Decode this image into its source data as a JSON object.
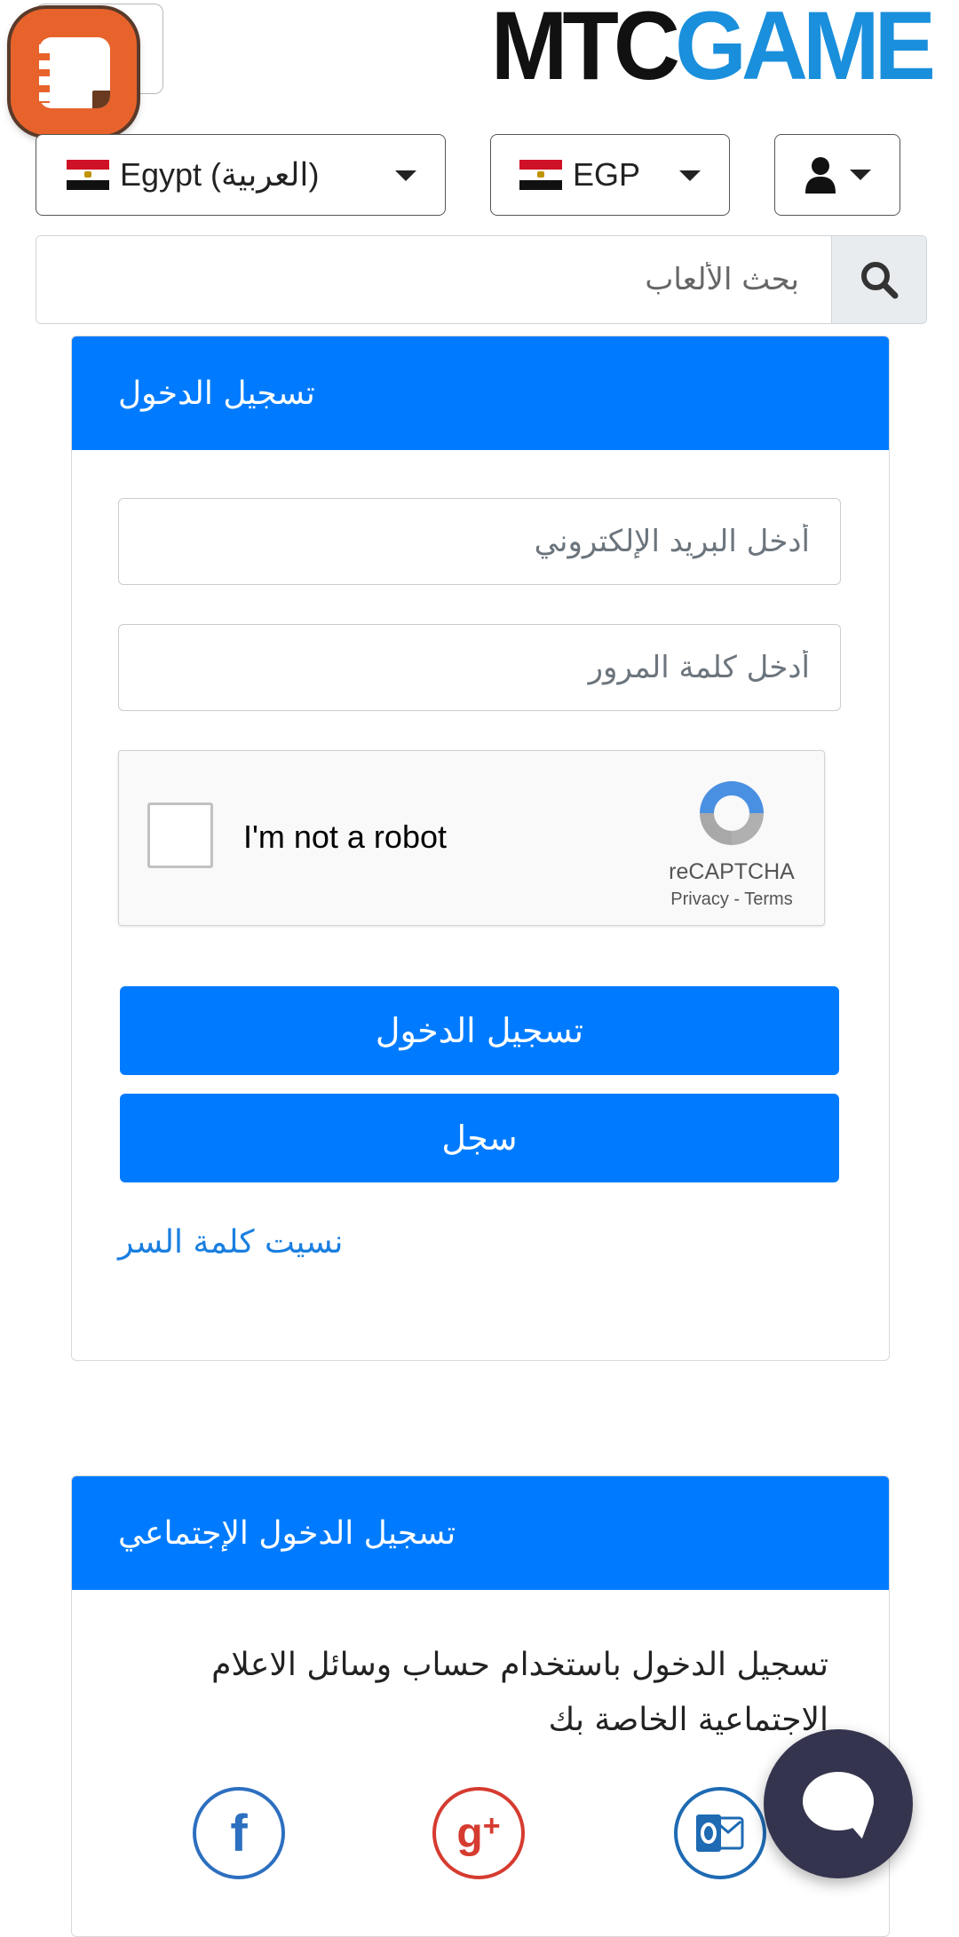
{
  "header": {
    "logo_part1": "MTC",
    "logo_part2": "GAME",
    "country_label": "Egypt (العربية)",
    "currency_label": "EGP",
    "search_placeholder": "بحث الألعاب"
  },
  "login": {
    "title": "تسجيل الدخول",
    "email_placeholder": "أدخل البريد الإلكتروني",
    "password_placeholder": "أدخل كلمة المرور",
    "captcha_label": "I'm not a robot",
    "captcha_brand": "reCAPTCHA",
    "captcha_links": "Privacy - Terms",
    "login_button": "تسجيل الدخول",
    "register_button": "سجل",
    "forgot_link": "نسيت كلمة السر"
  },
  "social": {
    "title": "تسجيل الدخول الإجتماعي",
    "text_line1": "تسجيل الدخول باستخدام حساب وسائل الاعلام",
    "text_line2": "الاجتماعية الخاصة بك"
  },
  "colors": {
    "primary": "#007bff",
    "logo_blue": "#1a8fdc",
    "badge_orange": "#e8632b",
    "chat_bg": "#34344e"
  },
  "icons": [
    "notes-app-icon",
    "egypt-flag-icon",
    "user-icon",
    "search-icon",
    "recaptcha-icon",
    "facebook-icon",
    "google-plus-icon",
    "outlook-icon",
    "chat-icon"
  ]
}
